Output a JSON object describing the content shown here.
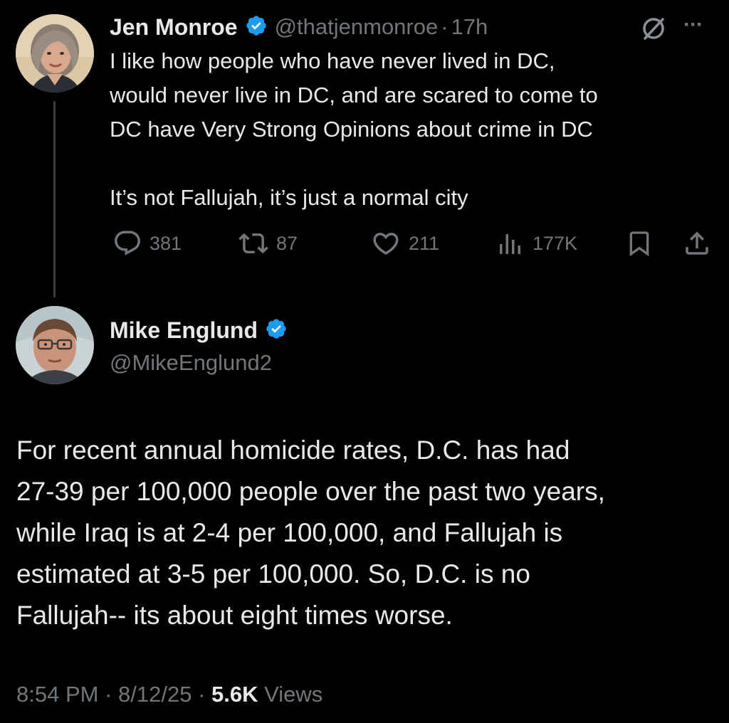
{
  "parent_tweet": {
    "author_name": "Jen Monroe",
    "handle": "@thatjenmonroe",
    "separator": "·",
    "time_ago": "17h",
    "text_lines": [
      "I like how people who have never lived in DC,",
      "would never live in DC, and are scared to come to",
      "DC have Very Strong Opinions about crime in DC",
      "",
      "It’s not Fallujah, it’s just a normal city"
    ],
    "actions": {
      "replies": "381",
      "reposts": "87",
      "likes": "211",
      "views": "177K"
    },
    "more_icon_text": "···"
  },
  "reply_tweet": {
    "author_name": "Mike Englund",
    "handle": "@MikeEnglund2",
    "text_lines": [
      "For recent annual homicide rates, D.C. has had",
      "27-39 per 100,000 people over the past two years,",
      "while Iraq is at 2-4 per 100,000, and Fallujah is",
      "estimated at 3-5 per 100,000. So, D.C. is no",
      "Fallujah-- its about eight times worse."
    ],
    "time": "8:54 PM",
    "sep1": " · ",
    "date": "8/12/25",
    "sep2": " · ",
    "views_count": "5.6K",
    "views_label": "Views"
  },
  "colors": {
    "background": "#000000",
    "text_primary": "#e7e9ea",
    "text_secondary": "#71767b",
    "verified_blue": "#1d9bf0",
    "thread_line": "#3a3f44"
  },
  "icons": [
    "verified-badge-icon",
    "grok-icon",
    "more-icon",
    "reply-icon",
    "repost-icon",
    "like-icon",
    "views-icon",
    "bookmark-icon",
    "share-icon"
  ]
}
